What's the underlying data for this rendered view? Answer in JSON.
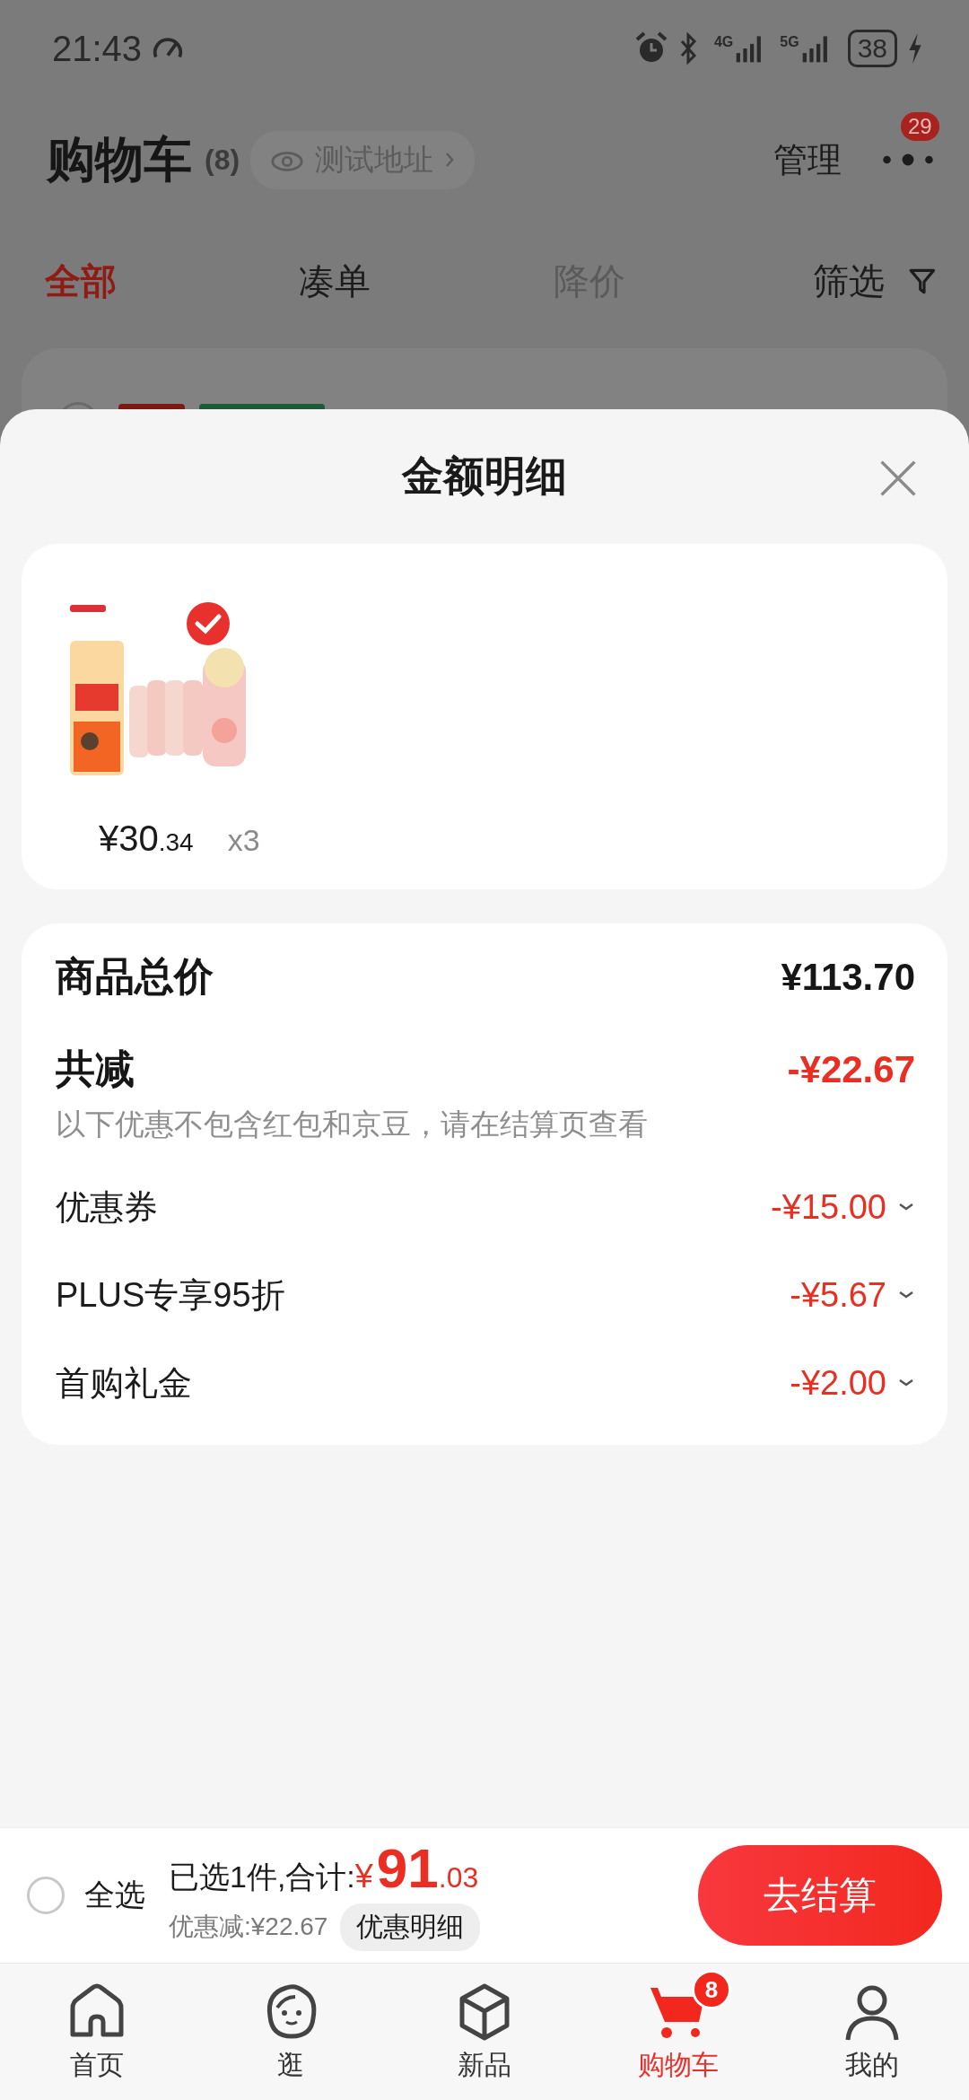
{
  "status_bar": {
    "time": "21:43",
    "networks": [
      "4G",
      "5G"
    ],
    "battery": "38"
  },
  "header": {
    "title": "购物车",
    "count": "(8)",
    "address": "测试地址",
    "manage": "管理",
    "more_badge": "29"
  },
  "tabs": [
    {
      "label": "全部",
      "selected": true,
      "disabled": false
    },
    {
      "label": "凑单",
      "selected": false,
      "disabled": false
    },
    {
      "label": "降价",
      "selected": false,
      "disabled": true
    }
  ],
  "filter": "筛选",
  "sheet": {
    "title": "金额明细",
    "product": {
      "checked": true,
      "price_main": "¥30",
      "price_fraction": ".34",
      "quantity": "x3"
    },
    "total": {
      "label": "商品总价",
      "value": "¥113.70"
    },
    "reduction": {
      "label": "共减",
      "value": "-¥22.67",
      "note": "以下优惠不包含红包和京豆，请在结算页查看"
    },
    "discounts": [
      {
        "label": "优惠券",
        "value": "-¥15.00"
      },
      {
        "label": "PLUS专享95折",
        "value": "-¥5.67"
      },
      {
        "label": "首购礼金",
        "value": "-¥2.00"
      }
    ]
  },
  "checkout_bar": {
    "select_all": {
      "label": "全选",
      "checked": false
    },
    "summary": "已选1件,合计:",
    "currency": "¥",
    "total_main": "91",
    "total_fraction": ".03",
    "saved": "优惠减:¥22.67",
    "detail_button": "优惠明细",
    "checkout_button": "去结算"
  },
  "nav": [
    {
      "kind": "home",
      "label": "首页",
      "selected": false
    },
    {
      "kind": "face",
      "label": "逛",
      "selected": false
    },
    {
      "kind": "box",
      "label": "新品",
      "selected": false
    },
    {
      "kind": "cart",
      "label": "购物车",
      "selected": true,
      "badge": "8"
    },
    {
      "kind": "person",
      "label": "我的",
      "selected": false
    }
  ]
}
